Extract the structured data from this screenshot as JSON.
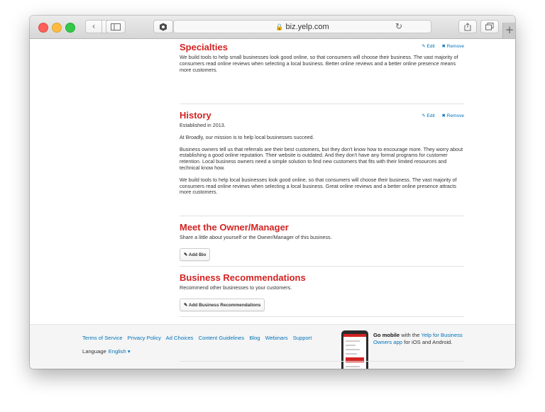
{
  "browser": {
    "url": "biz.yelp.com",
    "back_glyph": "‹",
    "forward_glyph": "›",
    "reload_glyph": "↻",
    "new_tab_glyph": "+"
  },
  "sections": {
    "specialties": {
      "title": "Specialties",
      "edit": "✎ Edit",
      "remove": "✖ Remove",
      "paragraphs": [
        "We build tools to help small businesses look good online, so that consumers will choose their business. The vast majority of consumers read online reviews when selecting a local business. Better online reviews and a better online presence means more customers."
      ]
    },
    "history": {
      "title": "History",
      "edit": "✎ Edit",
      "remove": "✖ Remove",
      "paragraphs": [
        "Established in 2013.",
        "At Broadly, our mission is to help local businesses succeed.",
        "Business owners tell us that referrals are their best customers, but they don't know how to encourage more. They worry about establishing a good online reputation. Their website is outdated. And they don't have any formal programs for customer retention. Local business owners need a simple solution to find new customers that fits with their limited resources and technical know how.",
        "We build tools to help local businesses look good online, so that consumers will choose their business. The vast majority of consumers read online reviews when selecting a local business. Great online reviews and a better online presence attracts more customers."
      ]
    },
    "owner": {
      "title": "Meet the Owner/Manager",
      "description": "Share a little about yourself or the Owner/Manager of this business.",
      "button": "✎ Add Bio"
    },
    "recommendations": {
      "title": "Business Recommendations",
      "description": "Recommend other businesses to your customers.",
      "button": "✎ Add Business Recommendations"
    }
  },
  "footer": {
    "links": [
      "Terms of Service",
      "Privacy Policy",
      "Ad Choices",
      "Content Guidelines",
      "Blog",
      "Webinars",
      "Support"
    ],
    "language_label": "Language",
    "language_value": "English ▾",
    "mobile_bold": "Go mobile",
    "mobile_text1": "with the",
    "mobile_link": "Yelp for Business Owners app",
    "mobile_text2": "for iOS and Android."
  },
  "colors": {
    "accent_red": "#d32323",
    "link_blue": "#0073bb"
  }
}
